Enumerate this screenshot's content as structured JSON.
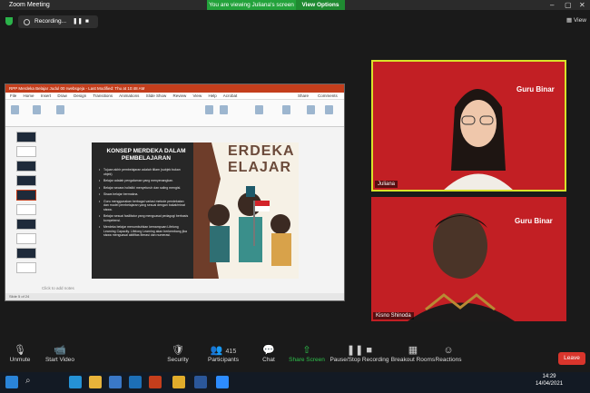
{
  "window": {
    "title": "Zoom Meeting"
  },
  "banner": {
    "viewing": "You are viewing Juliana's screen",
    "view_options": "View Options"
  },
  "recording": {
    "label": "Recording..."
  },
  "top_right": {
    "view": "View"
  },
  "ppt": {
    "title_bar": "RPP Merdeka Belajar Judul 00 rwebsgeja - Last Modified: Thu at 10:48 AM",
    "menu": [
      "File",
      "Home",
      "Insert",
      "Draw",
      "Design",
      "Transitions",
      "Animations",
      "Slide Show",
      "Review",
      "View",
      "Help",
      "Acrobat"
    ],
    "share": "Share",
    "comments": "Comments",
    "notes": "Click to add notes",
    "status": "Slide 5 of 24"
  },
  "slide": {
    "title": "KONSEP MERDEKA DALAM PEMBELAJARAN",
    "big_text": [
      "ERDEKA",
      "ELAJAR"
    ],
    "bullets": [
      "Tujuan akhir pembelajaran adalah tiliam (subjek bukan objek)",
      "Belajar adalah pengalaman yang menyenangkan.",
      "Belajar secara holistik/ menyeluruh dan saling mengisi.",
      "Siswa belajar bermakna.",
      "Guru menggunakan berbagai variasi metode pendekatan dan model pembelajaran yang sesuai dengan bakat/minat siswa.",
      "Belajar sesuai fasilitator yang menguasai pedagogi berbasis kompetensi.",
      "Merdeka belajar menumbuhkan kemampuan Lifelong Learning Capacity. Lifelong Learning akan berkembang jika siswa menguasai aktifitas literasi dan numerasi."
    ]
  },
  "participants": [
    {
      "name": "Juliana",
      "logo": "Guru Binar"
    },
    {
      "name": "Kisno Shinoda",
      "logo": "Guru Binar"
    }
  ],
  "toolbar": {
    "unmute": "Unmute",
    "video": "Start Video",
    "security": "Security",
    "participants": "Participants",
    "participants_count": "415",
    "chat": "Chat",
    "share": "Share Screen",
    "pause": "Pause/Stop Recording",
    "breakout": "Breakout Rooms",
    "reactions": "Reactions",
    "leave": "Leave"
  },
  "clock": {
    "time": "14:29",
    "date": "14/04/2021"
  },
  "colors": {
    "accent": "#c21f24",
    "share": "#23a23b",
    "leave": "#d9352c"
  }
}
